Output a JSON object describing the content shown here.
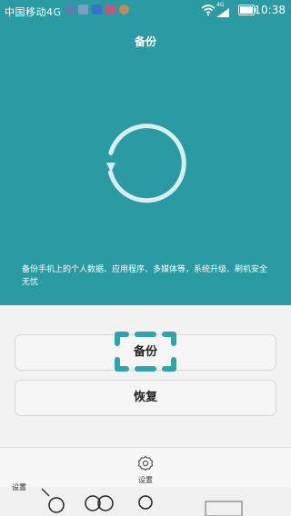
{
  "status_bar": {
    "carrier": "中国移动4G",
    "network": "4G",
    "time": "10:38"
  },
  "header": {
    "title": "备份",
    "description": "备份手机上的个人数据、应用程序、多媒体等，系统升级、刷机安全无忧"
  },
  "actions": {
    "backup_label": "备份",
    "restore_label": "恢复"
  },
  "bottom_bar": {
    "settings_label": "设置"
  },
  "overlay": {
    "corner_label": "设置"
  },
  "colors": {
    "accent": "#2a9ba3",
    "focus_marker": "#2fa4ab"
  }
}
